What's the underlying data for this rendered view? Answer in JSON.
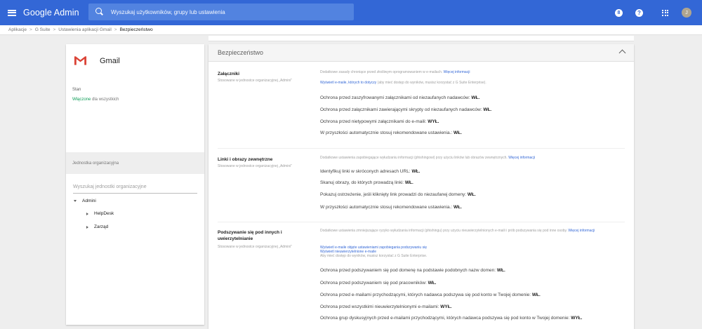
{
  "topbar": {
    "brand": "Google Admin",
    "search_placeholder": "Wyszukaj użytkowników, grupy lub ustawienia",
    "notif_glyph": "8",
    "help_glyph": "?",
    "avatar_initial": "J",
    "accent_color": "#3367d6"
  },
  "breadcrumb": {
    "items": [
      "Aplikacje",
      "G Suite",
      "Ustawienia aplikacji Gmail"
    ],
    "current": "Bezpieczeństwo",
    "separator": ">"
  },
  "left": {
    "app_name": "Gmail",
    "status_label": "Stan",
    "status_on": "Włączone",
    "status_rest": "dla wszystkich",
    "ou_header": "Jednostka organizacyjna",
    "ou_search_placeholder": "Wyszukaj jednostki organizacyjne",
    "tree": {
      "root": "Admini",
      "children": [
        "HelpDesk",
        "Zarząd"
      ]
    }
  },
  "main": {
    "section_title": "Bezpieczeństwo",
    "attachments": {
      "title": "Załączniki",
      "subtitle": "Stosowane w jednostce organizacyjnej „Admini”",
      "desc": "Dodatkowe zasady chroniące przed złośliwym oprogramowaniem w e-mailach.",
      "more_link": "Więcej informacji",
      "view_link": "Wyświetl e-maile, których to dotyczy",
      "view_note": "(aby mieć dostęp do wyników, musisz korzystać z G Suite Enterprise).",
      "settings": [
        {
          "label": "Ochrona przed zaszyfrowanymi załącznikami od niezaufanych nadawców:",
          "value": "WŁ."
        },
        {
          "label": "Ochrona przed załącznikami zawierającymi skrypty od niezaufanych nadawców:",
          "value": "WŁ."
        },
        {
          "label": "Ochrona przed nietypowymi załącznikami do e-maili:",
          "value": "WYŁ."
        },
        {
          "label": "W przyszłości automatycznie stosuj rekomendowane ustawienia.:",
          "value": "WŁ."
        }
      ]
    },
    "links": {
      "title": "Linki i obrazy zewnętrzne",
      "subtitle": "Stosowane w jednostce organizacyjnej „Admini”",
      "desc": "Dodatkowe ustawienia zapobiegające wyłudzaniu informacji (phishingowi) przy użyciu linków lub obrazów zewnętrznych.",
      "more_link": "Więcej informacji",
      "settings": [
        {
          "label": "Identyfikuj linki w skróconych adresach URL:",
          "value": "WŁ."
        },
        {
          "label": "Skanuj obrazy, do których prowadzą linki:",
          "value": "WŁ."
        },
        {
          "label": "Pokazuj ostrzeżenie, jeśli kliknięty link prowadzi do niezaufanej domeny:",
          "value": "WŁ."
        },
        {
          "label": "W przyszłości automatycznie stosuj rekomendowane ustawienia.:",
          "value": "WŁ."
        }
      ]
    },
    "spoofing": {
      "title_line1": "Podszywanie się pod innych i",
      "title_line2": "uwierzytelnianie",
      "subtitle": "Stosowane w jednostce organizacyjnej „Admini”",
      "desc": "Dodatkowe ustawienia zmniejszające ryzyko wyłudzania informacji (phishingu) przy użyciu nieuwierzytelnionych e-maili i prób podszywania się pod inne osoby.",
      "more_link": "Więcej informacji",
      "view_link1": "Wyświetl e-maile objęte ustawieniami zapobiegania podszywaniu się",
      "view_link2": "Wyświetl nieuwierzytelnione e-maile",
      "view_note": "Aby mieć dostęp do wyników, musisz korzystać z G Suite Enterprise.",
      "settings": [
        {
          "label": "Ochrona przed podszywaniem się pod domenę na podstawie podobnych nazw domen:",
          "value": "WŁ."
        },
        {
          "label": "Ochrona przed podszywaniem się pod pracowników:",
          "value": "WŁ."
        },
        {
          "label": "Ochrona przed e-mailami przychodzącymi, których nadawca podszywa się pod konto w Twojej domenie:",
          "value": "WŁ."
        },
        {
          "label": "Ochrona przed wszystkimi nieuwierzytelnionymi e-mailami:",
          "value": "WYŁ."
        },
        {
          "label": "Ochrona grup dyskusyjnych przed e-mailami przychodzącymi, których nadawca podszywa się pod konto w Twojej domenie:",
          "value": "WYŁ."
        }
      ]
    }
  }
}
